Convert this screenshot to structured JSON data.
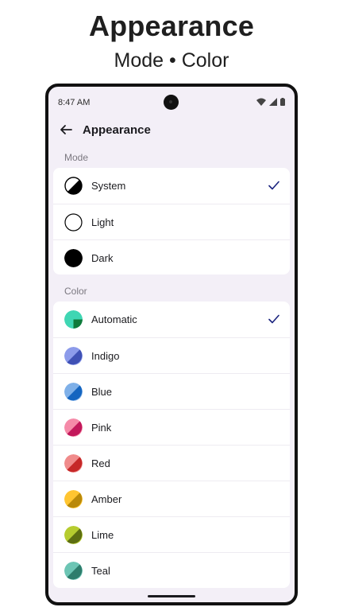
{
  "promo": {
    "title": "Appearance",
    "subtitle": "Mode • Color"
  },
  "status_bar": {
    "time": "8:47 AM",
    "icons": [
      "wifi-icon",
      "cell-signal-icon",
      "battery-icon"
    ]
  },
  "app_bar": {
    "title": "Appearance",
    "back_icon": "arrow-left-icon"
  },
  "mode_section": {
    "header": "Mode",
    "options": [
      {
        "label": "System",
        "icon": "half-contrast-icon",
        "selected": true
      },
      {
        "label": "Light",
        "icon": "outline-circle-icon",
        "selected": false
      },
      {
        "label": "Dark",
        "icon": "filled-circle-icon",
        "selected": false
      }
    ]
  },
  "color_section": {
    "header": "Color",
    "options": [
      {
        "label": "Automatic",
        "selected": true,
        "colors": [
          "#3fd6b3",
          "#1c9b6b",
          "#0f7a3a"
        ]
      },
      {
        "label": "Indigo",
        "selected": false,
        "colors": [
          "#8c9bea",
          "#3f51b5"
        ]
      },
      {
        "label": "Blue",
        "selected": false,
        "colors": [
          "#7fb0e8",
          "#1565c0"
        ]
      },
      {
        "label": "Pink",
        "selected": false,
        "colors": [
          "#f58aa8",
          "#c2185b"
        ]
      },
      {
        "label": "Red",
        "selected": false,
        "colors": [
          "#f08b8b",
          "#c62828"
        ]
      },
      {
        "label": "Amber",
        "selected": false,
        "colors": [
          "#ffc531",
          "#b9890a"
        ]
      },
      {
        "label": "Lime",
        "selected": false,
        "colors": [
          "#b6cc2f",
          "#5d6e12"
        ]
      },
      {
        "label": "Teal",
        "selected": false,
        "colors": [
          "#6cc5b4",
          "#2e7d6c"
        ]
      }
    ]
  },
  "colors": {
    "accent": "#1a237e",
    "background": "#f3eff7",
    "card": "#ffffff"
  }
}
